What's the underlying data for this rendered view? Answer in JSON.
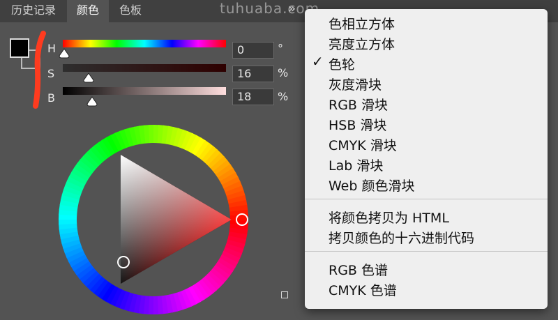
{
  "tabs": [
    {
      "label": "历史记录",
      "active": false
    },
    {
      "label": "颜色",
      "active": true
    },
    {
      "label": "色板",
      "active": false
    }
  ],
  "watermark": "tuhuaba.com",
  "expand_icon": "»",
  "sliders": {
    "h": {
      "label": "H",
      "value": "0",
      "unit": "°",
      "fraction": 0.0
    },
    "s": {
      "label": "S",
      "value": "16",
      "unit": "%",
      "fraction": 0.16
    },
    "b": {
      "label": "B",
      "value": "18",
      "unit": "%",
      "fraction": 0.18
    }
  },
  "colors": {
    "foreground": "#000000",
    "accent_annotation": "#ff3b1f",
    "panel_bg": "#535353",
    "menu_bg": "#efefef"
  },
  "menu": {
    "group1": [
      "色相立方体",
      "亮度立方体",
      "色轮",
      "灰度滑块",
      "RGB 滑块",
      "HSB 滑块",
      "CMYK 滑块",
      "Lab 滑块",
      "Web 颜色滑块"
    ],
    "checked_index": 2,
    "check_mark": "✓",
    "group2": [
      "将颜色拷贝为 HTML",
      "拷贝颜色的十六进制代码"
    ],
    "group3": [
      "RGB 色谱",
      "CMYK 色谱"
    ]
  }
}
